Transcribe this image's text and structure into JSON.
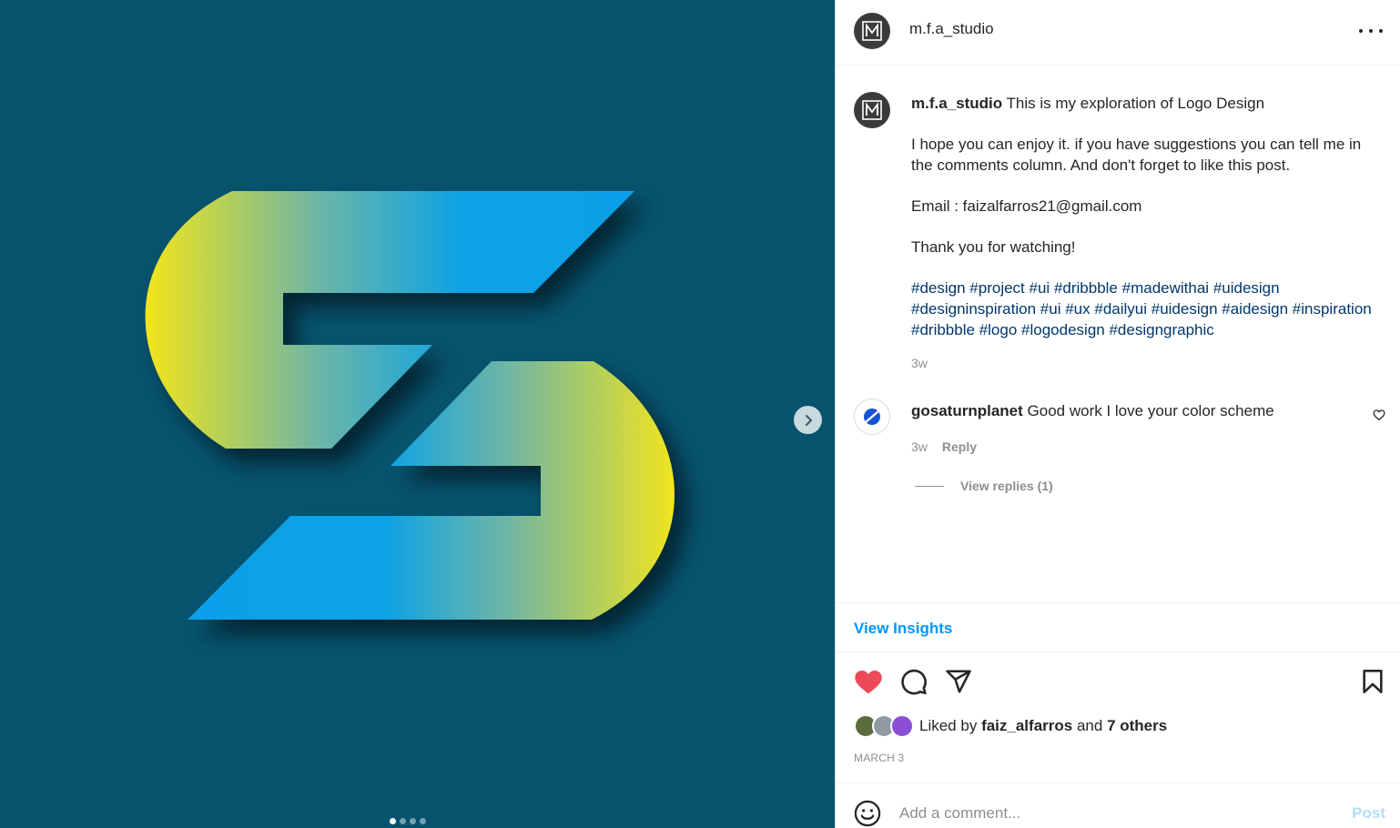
{
  "post": {
    "username": "m.f.a_studio",
    "avatar_monogram": "M"
  },
  "caption": {
    "username": "m.f.a_studio",
    "title": "This is my exploration of Logo Design",
    "paragraph1": "I hope you can enjoy it. if you have suggestions you can tell me in the comments column. And don't forget to like this post.",
    "email": "Email : faizalfarros21@gmail.com",
    "thanks": "Thank you for watching!",
    "hashtags": [
      "#design",
      "#project",
      "#ui",
      "#dribbble",
      "#madewithai",
      "#uidesign",
      "#designinspiration",
      "#ui",
      "#ux",
      "#dailyui",
      "#uidesign",
      "#aidesign",
      "#inspiration",
      "#dribbble",
      "#logo",
      "#logodesign",
      "#designgraphic"
    ],
    "time": "3w"
  },
  "comment": {
    "username": "gosaturnplanet",
    "text": "Good work I love your color scheme",
    "time": "3w",
    "reply_label": "Reply",
    "view_replies": "View replies (1)"
  },
  "insights_label": "View Insights",
  "likes": {
    "prefix": "Liked by",
    "user": "faiz_alfarros",
    "and": "and",
    "others": "7 others"
  },
  "date": "MARCH 3",
  "comment_input": {
    "placeholder": "Add a comment...",
    "post_label": "Post"
  },
  "carousel": {
    "slide_count": 4,
    "current": 1
  },
  "colors": {
    "media_bg": "#06536e",
    "logo_blue": "#0aa0e8",
    "logo_yellow": "#f4e61a",
    "link_blue": "#0095f6",
    "hashtag": "#00376b",
    "like_red": "#ed4956"
  },
  "icons": {
    "more": "more-horizontal-icon",
    "next": "chevron-right-icon",
    "heart": "heart-icon",
    "comment": "comment-bubble-icon",
    "share": "paper-plane-icon",
    "save": "bookmark-icon",
    "emoji": "smiley-icon"
  }
}
